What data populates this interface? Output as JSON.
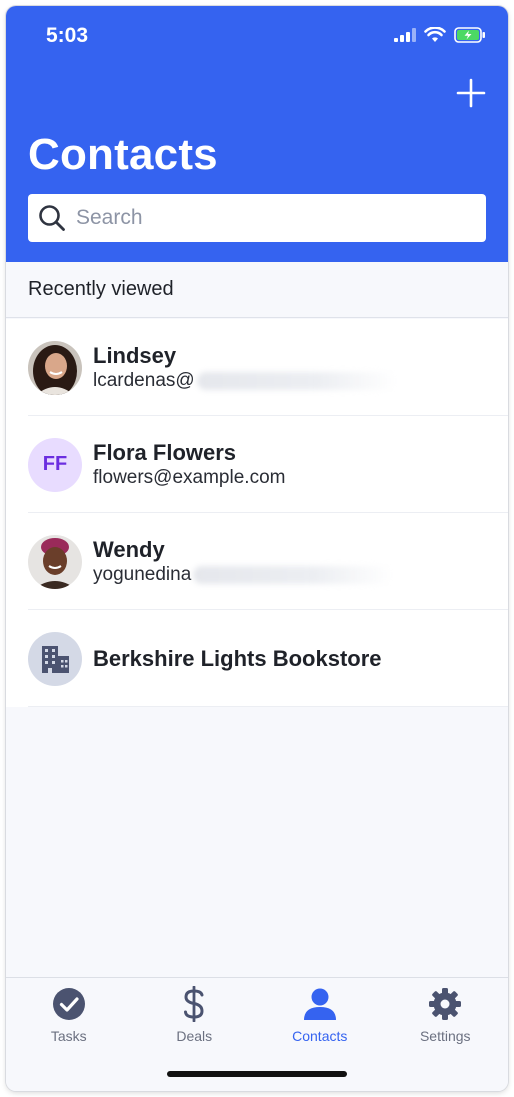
{
  "status_bar": {
    "time": "5:03"
  },
  "header": {
    "title": "Contacts",
    "add_icon": "plus-icon",
    "search": {
      "placeholder": "Search",
      "value": "",
      "icon": "search-icon"
    }
  },
  "section": {
    "title": "Recently viewed"
  },
  "contacts": [
    {
      "name": "Lindsey",
      "email": "lcardenas@",
      "avatar": "photo"
    },
    {
      "name": "Flora Flowers",
      "email": "flowers@example.com",
      "avatar": "initials",
      "initials": "FF"
    },
    {
      "name": "Wendy",
      "email": "yogunedina",
      "avatar": "photo"
    },
    {
      "name": "Berkshire Lights Bookstore",
      "email": "",
      "avatar": "building-icon"
    }
  ],
  "tabs": [
    {
      "label": "Tasks",
      "icon": "check-circle-icon",
      "active": false
    },
    {
      "label": "Deals",
      "icon": "dollar-icon",
      "active": false
    },
    {
      "label": "Contacts",
      "icon": "person-icon",
      "active": true
    },
    {
      "label": "Settings",
      "icon": "gear-icon",
      "active": false
    }
  ],
  "colors": {
    "header": "#3563f0",
    "active_tab": "#3563f0",
    "inactive_tab": "#6b7080",
    "initials_bg": "#e8dcff"
  }
}
